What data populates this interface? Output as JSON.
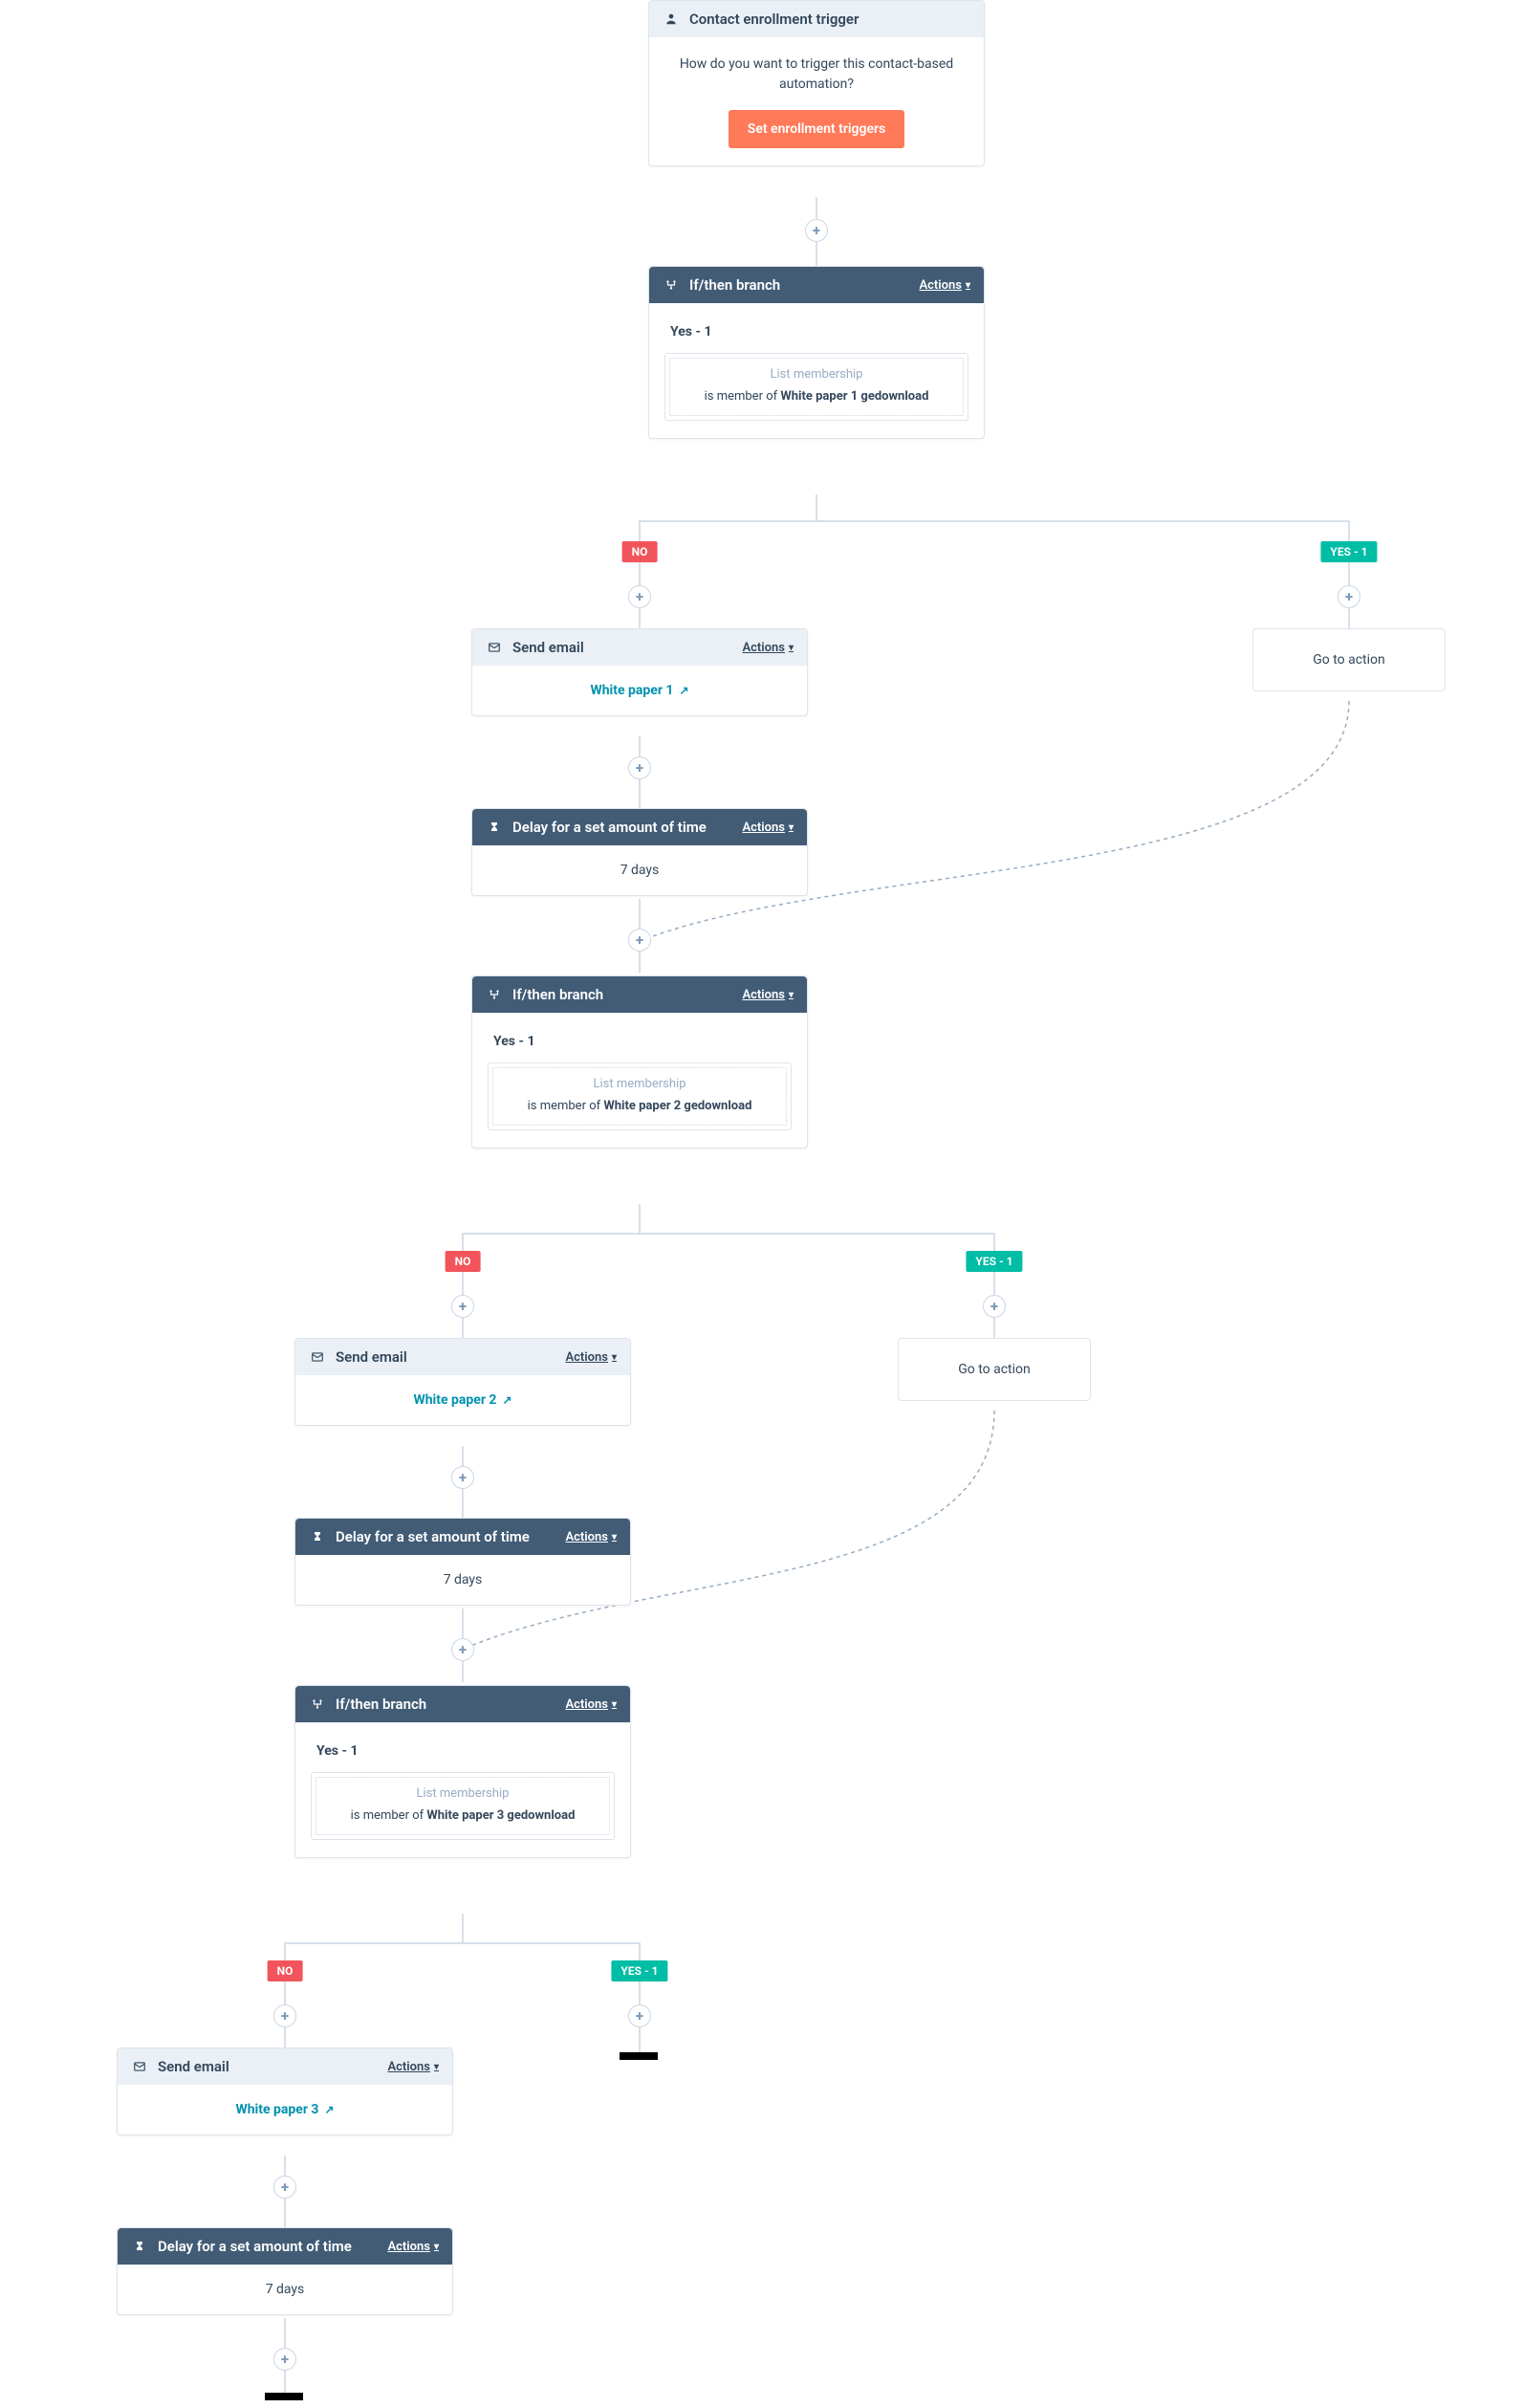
{
  "trigger": {
    "title": "Contact enrollment trigger",
    "question": "How do you want to trigger this contact-based automation?",
    "button": "Set enrollment triggers"
  },
  "labels": {
    "ifthen": "If/then branch",
    "send": "Send email",
    "delay": "Delay for a set amount of time",
    "actions": "Actions",
    "goto": "Go to action",
    "no": "NO",
    "yes1": "YES - 1",
    "yes_s": "Yes - 1",
    "listmem": "List membership",
    "memberof": "is member of "
  },
  "branch1": {
    "list": "White paper 1 gedownload"
  },
  "branch2": {
    "list": "White paper 2 gedownload"
  },
  "branch3": {
    "list": "White paper 3 gedownload"
  },
  "email1": "White paper 1",
  "email2": "White paper 2",
  "email3": "White paper 3",
  "delay_val": "7 days"
}
